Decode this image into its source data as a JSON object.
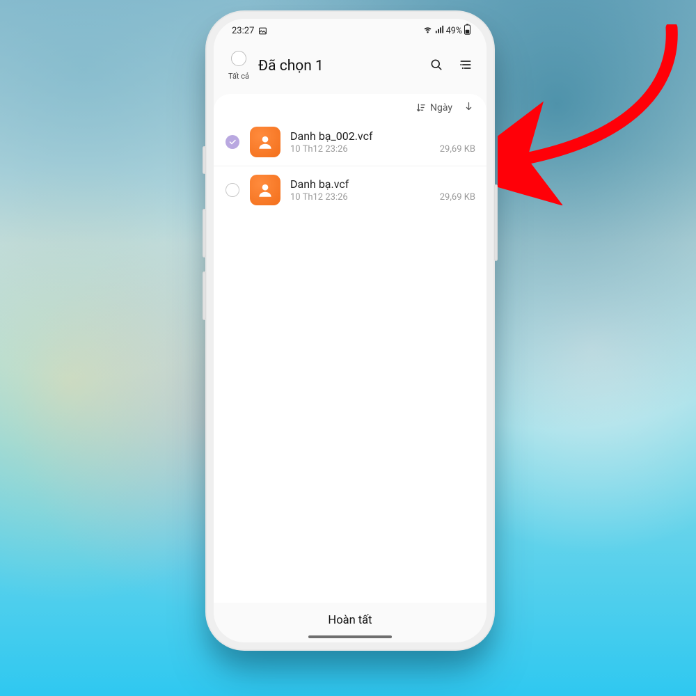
{
  "status": {
    "time": "23:27",
    "battery": "49%"
  },
  "header": {
    "all_label": "Tất cả",
    "title": "Đã chọn 1"
  },
  "sort": {
    "label": "Ngày"
  },
  "files": [
    {
      "name": "Danh bạ_002.vcf",
      "date": "10 Th12 23:26",
      "size": "29,69 KB",
      "selected": true
    },
    {
      "name": "Danh bạ.vcf",
      "date": "10 Th12 23:26",
      "size": "29,69 KB",
      "selected": false
    }
  ],
  "footer": {
    "done": "Hoàn tất"
  }
}
